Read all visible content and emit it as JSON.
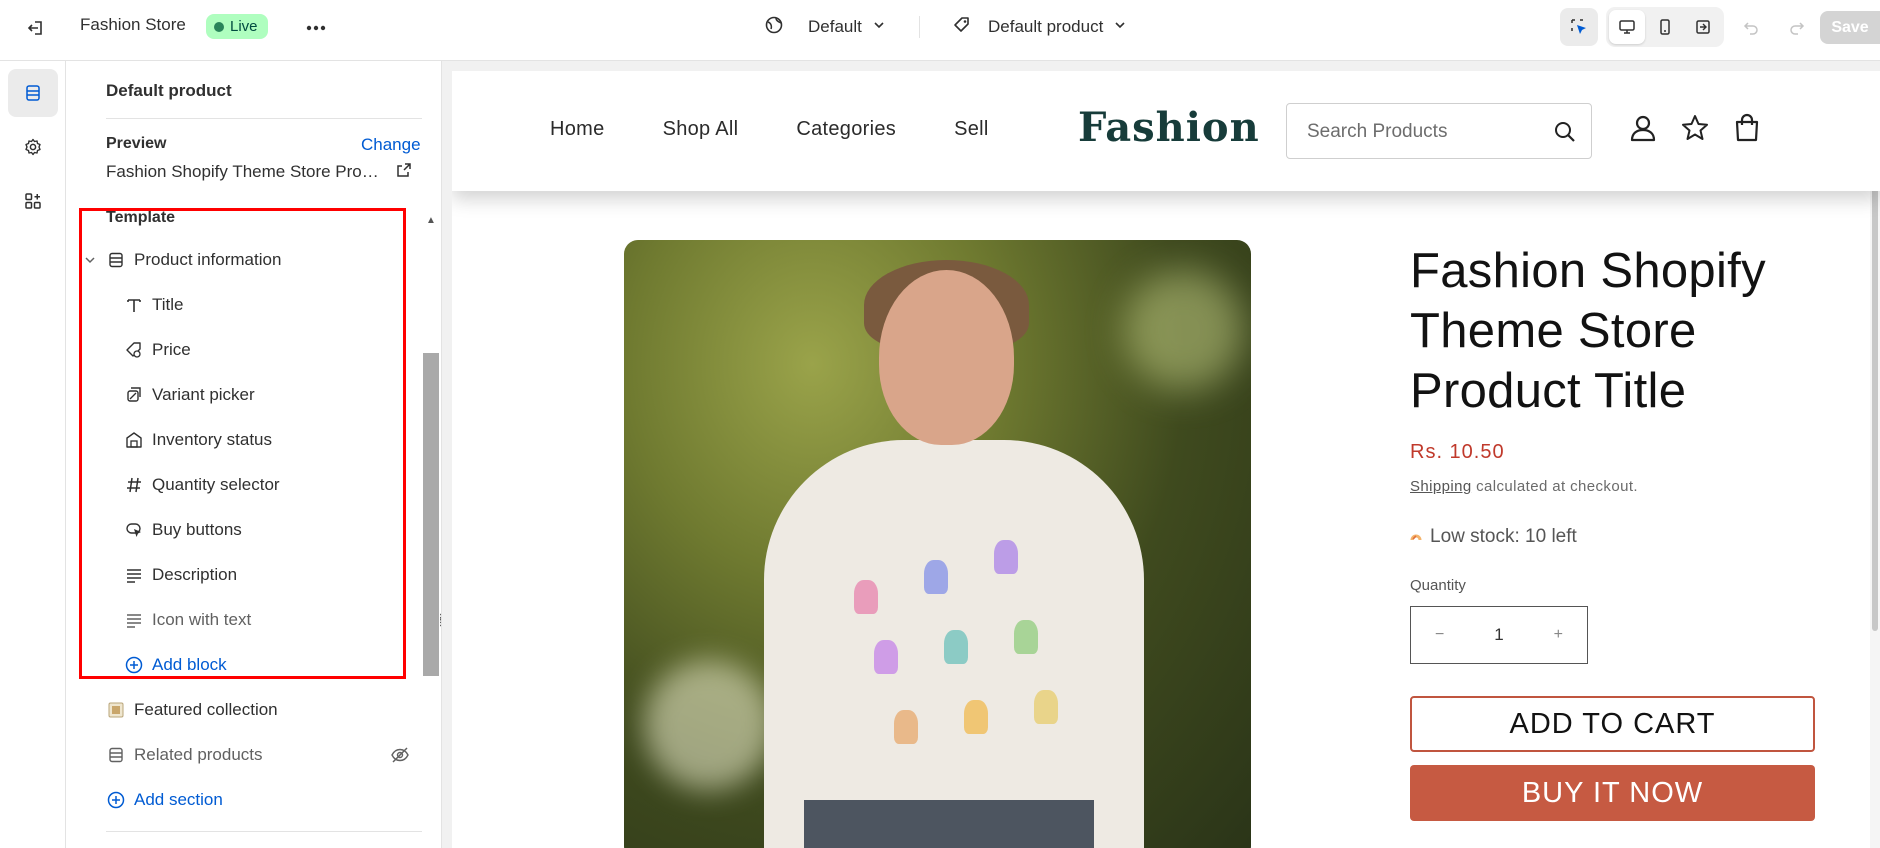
{
  "topbar": {
    "store_name": "Fashion Store",
    "status_badge": "Live",
    "theme_select": "Default",
    "template_select": "Default product",
    "save_label": "Save"
  },
  "sidebar": {
    "title": "Default product",
    "preview_label": "Preview",
    "change_link": "Change",
    "preview_value": "Fashion Shopify Theme Store Product Title",
    "template_label": "Template",
    "section": {
      "label": "Product information",
      "expanded": true,
      "blocks": [
        {
          "label": "Title",
          "icon": "text-icon",
          "hidden": false
        },
        {
          "label": "Price",
          "icon": "price-tag-icon",
          "hidden": false
        },
        {
          "label": "Variant picker",
          "icon": "variant-icon",
          "hidden": false
        },
        {
          "label": "Inventory status",
          "icon": "inventory-icon",
          "hidden": false
        },
        {
          "label": "Quantity selector",
          "icon": "hash-icon",
          "hidden": false
        },
        {
          "label": "Buy buttons",
          "icon": "cursor-icon",
          "hidden": false
        },
        {
          "label": "Description",
          "icon": "paragraph-icon",
          "hidden": false
        },
        {
          "label": "Icon with text",
          "icon": "paragraph-icon",
          "hidden": true
        }
      ],
      "add_block": "Add block"
    },
    "sections": [
      {
        "label": "Featured collection",
        "icon": "collection-icon",
        "hidden": false
      },
      {
        "label": "Related products",
        "icon": "section-icon",
        "hidden": true
      }
    ],
    "add_section": "Add section"
  },
  "storefront": {
    "nav": [
      "Home",
      "Shop All",
      "Categories",
      "Sell"
    ],
    "logo": "Fashion",
    "search_placeholder": "Search Products",
    "product": {
      "title": "Fashion Shopify Theme Store Product Title",
      "price": "Rs. 10.50",
      "shipping_link": "Shipping",
      "shipping_text": " calculated at checkout.",
      "stock": "Low stock: 10 left",
      "quantity_label": "Quantity",
      "quantity_value": "1",
      "minus": "−",
      "plus": "+",
      "add_to_cart": "ADD TO CART",
      "buy_now": "BUY IT NOW"
    }
  },
  "colors": {
    "accent_link": "#005bd3",
    "highlight": "#ff0000",
    "live_badge": "#affebf",
    "price": "#c0392b",
    "buy_button": "#c65a42",
    "logo": "#173c3a"
  }
}
